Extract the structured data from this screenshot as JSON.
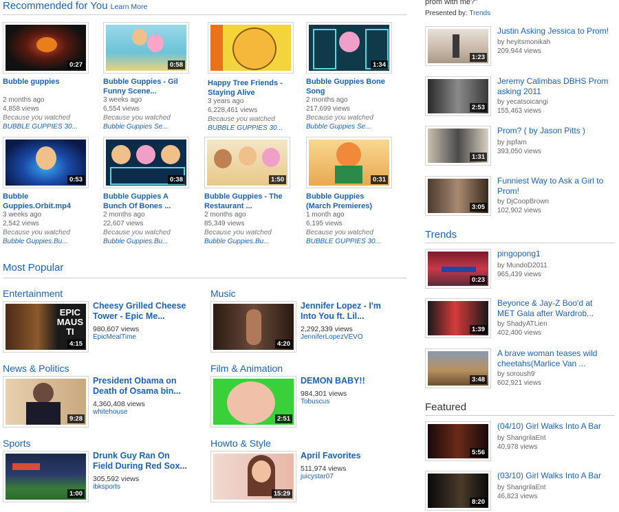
{
  "recommended": {
    "title": "Recommended for You",
    "learn_more": "Learn More",
    "videos": [
      {
        "title_lines": [
          "Bubble guppies"
        ],
        "duration": "0:27",
        "age": "2 months ago",
        "views": "4,858 views",
        "because": "Because you watched",
        "source": "BUBBLE GUPPIES 30..."
      },
      {
        "title_lines": [
          "Bubble Guppies - Gil",
          "Funny Scene..."
        ],
        "duration": "0:58",
        "age": "3 weeks ago",
        "views": "6,554 views",
        "because": "Because you watched",
        "source": "Bubble Guppies Se..."
      },
      {
        "title_lines": [
          "Happy Tree Friends -",
          "Staying Alive"
        ],
        "duration": "",
        "age": "3 years ago",
        "views": "6,228,461 views",
        "because": "Because you watched",
        "source": "BUBBLE GUPPIES 30..."
      },
      {
        "title_lines": [
          "Bubble Guppies Bone",
          "Song"
        ],
        "duration": "1:34",
        "age": "2 months ago",
        "views": "217,699 views",
        "because": "Because you watched",
        "source": "Bubble Guppies Se..."
      },
      {
        "title_lines": [
          "Bubble",
          "Guppies.Orbit.mp4"
        ],
        "duration": "0:53",
        "age": "3 weeks ago",
        "views": "2,542 views",
        "because": "Because you watched",
        "source": "Bubble Guppies.Bu..."
      },
      {
        "title_lines": [
          "Bubble Guppies A",
          "Bunch Of Bones ..."
        ],
        "duration": "0:38",
        "age": "2 months ago",
        "views": "22,607 views",
        "because": "Because you watched",
        "source": "Bubble Guppies.Bu..."
      },
      {
        "title_lines": [
          "Bubble Guppies - The",
          "Restaurant ..."
        ],
        "duration": "1:50",
        "age": "2 months ago",
        "views": "85,349 views",
        "because": "Because you watched",
        "source": "Bubble Guppies.Bu..."
      },
      {
        "title_lines": [
          "Bubble Guppies",
          "(March Premieres)"
        ],
        "duration": "0:31",
        "age": "1 month ago",
        "views": "6,195 views",
        "because": "Because you watched",
        "source": "BUBBLE GUPPIES 30..."
      }
    ]
  },
  "most_popular": {
    "title": "Most Popular",
    "categories": [
      {
        "name": "Entertainment",
        "title_lines": [
          "Cheesy Grilled Cheese",
          "Tower - Epic Me..."
        ],
        "views": "980,607 views",
        "user": "EpicMealTime",
        "duration": "4:15"
      },
      {
        "name": "Music",
        "title_lines": [
          "Jennifer Lopez - I'm",
          "Into You ft. Lil..."
        ],
        "views": "2,292,339 views",
        "user": "JenniferLopezVEVO",
        "duration": "4:20"
      },
      {
        "name": "News & Politics",
        "title_lines": [
          "President Obama on",
          "Death of Osama bin..."
        ],
        "views": "4,360,408 views",
        "user": "whitehouse",
        "duration": "9:28"
      },
      {
        "name": "Film & Animation",
        "title_lines": [
          "DEMON BABY!!"
        ],
        "views": "984,301 views",
        "user": "Tobuscus",
        "duration": "2:51"
      },
      {
        "name": "Sports",
        "title_lines": [
          "Drunk Guy Ran On",
          "Field During Red Sox..."
        ],
        "views": "305,592 views",
        "user": "ibksports",
        "duration": "1:00"
      },
      {
        "name": "Howto & Style",
        "title_lines": [
          "April Favorites"
        ],
        "views": "511,974 views",
        "user": "juicystar07",
        "duration": "15:29"
      }
    ]
  },
  "sidebar": {
    "top_text": "prom with me?\"",
    "presented_by_label": "Presented by:",
    "presented_by_link": "Trends",
    "prom_videos": [
      {
        "title_lines": [
          "Justin Asking Jessica to Prom!"
        ],
        "by": "by heyitsmonikah",
        "views": "209,944 views",
        "duration": "1:23"
      },
      {
        "title_lines": [
          "Jeremy Calimbas DBHS Prom",
          "asking 2011"
        ],
        "by": "by yecatsoicangi",
        "views": "155,463 views",
        "duration": "2:53"
      },
      {
        "title_lines": [
          "Prom? ( by Jason Pitts )"
        ],
        "by": "by jspfam",
        "views": "393,050 views",
        "duration": "1:31"
      },
      {
        "title_lines": [
          "Funniest Way to Ask a Girl to",
          "Prom!"
        ],
        "by": "by DjCoopBrown",
        "views": "102,902 views",
        "duration": "3:05"
      }
    ],
    "trends_title": "Trends",
    "trends_videos": [
      {
        "title_lines": [
          "pingopong1"
        ],
        "by": "by MundoD2011",
        "views": "965,439 views",
        "duration": "0:23"
      },
      {
        "title_lines": [
          "Beyonce & Jay-Z Boo'd at",
          "MET Gala after Wardrob..."
        ],
        "by": "by ShadyATLien",
        "views": "402,400 views",
        "duration": "1:39"
      },
      {
        "title_lines": [
          "A brave woman teases wild",
          "cheetahs(Marlice Van ..."
        ],
        "by": "by soroush9",
        "views": "602,921 views",
        "duration": "3:48"
      }
    ],
    "featured_title": "Featured",
    "featured_videos": [
      {
        "title_lines": [
          "(04/10) Girl Walks Into A Bar"
        ],
        "by": "by ShangrilaEnt",
        "views": "40,978 views",
        "duration": "5:56"
      },
      {
        "title_lines": [
          "(03/10) Girl Walks Into A Bar"
        ],
        "by": "by ShangrilaEnt",
        "views": "46,823 views",
        "duration": "8:20"
      }
    ]
  }
}
